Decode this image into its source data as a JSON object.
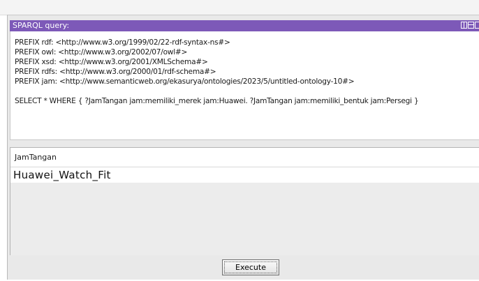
{
  "panel": {
    "title": "SPARQL query:"
  },
  "query": {
    "lines": [
      "PREFIX rdf: <http://www.w3.org/1999/02/22-rdf-syntax-ns#>",
      "PREFIX owl: <http://www.w3.org/2002/07/owl#>",
      "PREFIX xsd: <http://www.w3.org/2001/XMLSchema#>",
      "PREFIX rdfs: <http://www.w3.org/2000/01/rdf-schema#>",
      "PREFIX jam: <http://www.semanticweb.org/ekasurya/ontologies/2023/5/untitled-ontology-10#>",
      "",
      "SELECT * WHERE { ?JamTangan jam:memiliki_merek jam:Huawei. ?JamTangan jam:memiliki_bentuk jam:Persegi }"
    ]
  },
  "results": {
    "column": "JamTangan",
    "rows": [
      "Huawei_Watch_Fit"
    ]
  },
  "buttons": {
    "execute": "Execute"
  },
  "colors": {
    "titlebar": "#7d59b8"
  }
}
